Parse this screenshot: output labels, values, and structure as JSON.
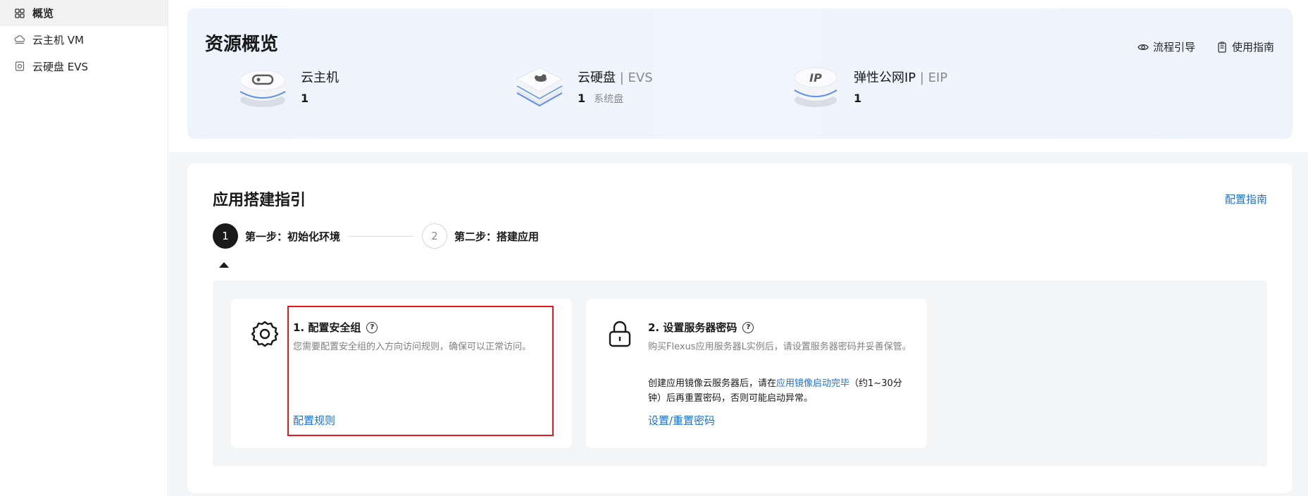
{
  "sidebar": {
    "items": [
      {
        "label": "概览",
        "icon": "grid-icon",
        "active": true
      },
      {
        "label": "云主机 VM",
        "icon": "cloud-icon",
        "active": false
      },
      {
        "label": "云硬盘 EVS",
        "icon": "disk-icon",
        "active": false
      }
    ]
  },
  "overview": {
    "title": "资源概览",
    "links": [
      {
        "label": "流程引导",
        "icon": "eye-icon"
      },
      {
        "label": "使用指南",
        "icon": "document-icon"
      }
    ],
    "resources": [
      {
        "name": "云主机",
        "sub": "",
        "value": "1",
        "note": "",
        "icon": "server-cloud-icon"
      },
      {
        "name": "云硬盘",
        "sub": " | EVS",
        "value": "1",
        "note": "系统盘",
        "icon": "disk-stack-icon"
      },
      {
        "name": "弹性公网IP",
        "sub": " | EIP",
        "value": "1",
        "note": "",
        "icon": "ip-icon"
      }
    ]
  },
  "guide": {
    "title": "应用搭建指引",
    "link": "配置指南",
    "steps": [
      {
        "num": "1",
        "label": "第一步：初始化环境",
        "active": true
      },
      {
        "num": "2",
        "label": "第二步：搭建应用",
        "active": false
      }
    ],
    "cards": [
      {
        "title": "1. 配置安全组",
        "desc": "您需要配置安全组的入方向访问规则，确保可以正常访问。",
        "action": "配置规则",
        "icon": "gear-icon"
      },
      {
        "title": "2. 设置服务器密码",
        "desc": "购买Flexus应用服务器L实例后，请设置服务器密码并妥善保管。",
        "desc2_pre": "创建应用镜像云服务器后，请在",
        "desc2_link": "应用镜像启动完毕",
        "desc2_post": "（约1~30分钟）后再重置密码，否则可能启动异常。",
        "action": "设置/重置密码",
        "icon": "lock-icon"
      }
    ]
  },
  "colors": {
    "accent": "#1e6fd9",
    "highlight": "#e8171e"
  }
}
